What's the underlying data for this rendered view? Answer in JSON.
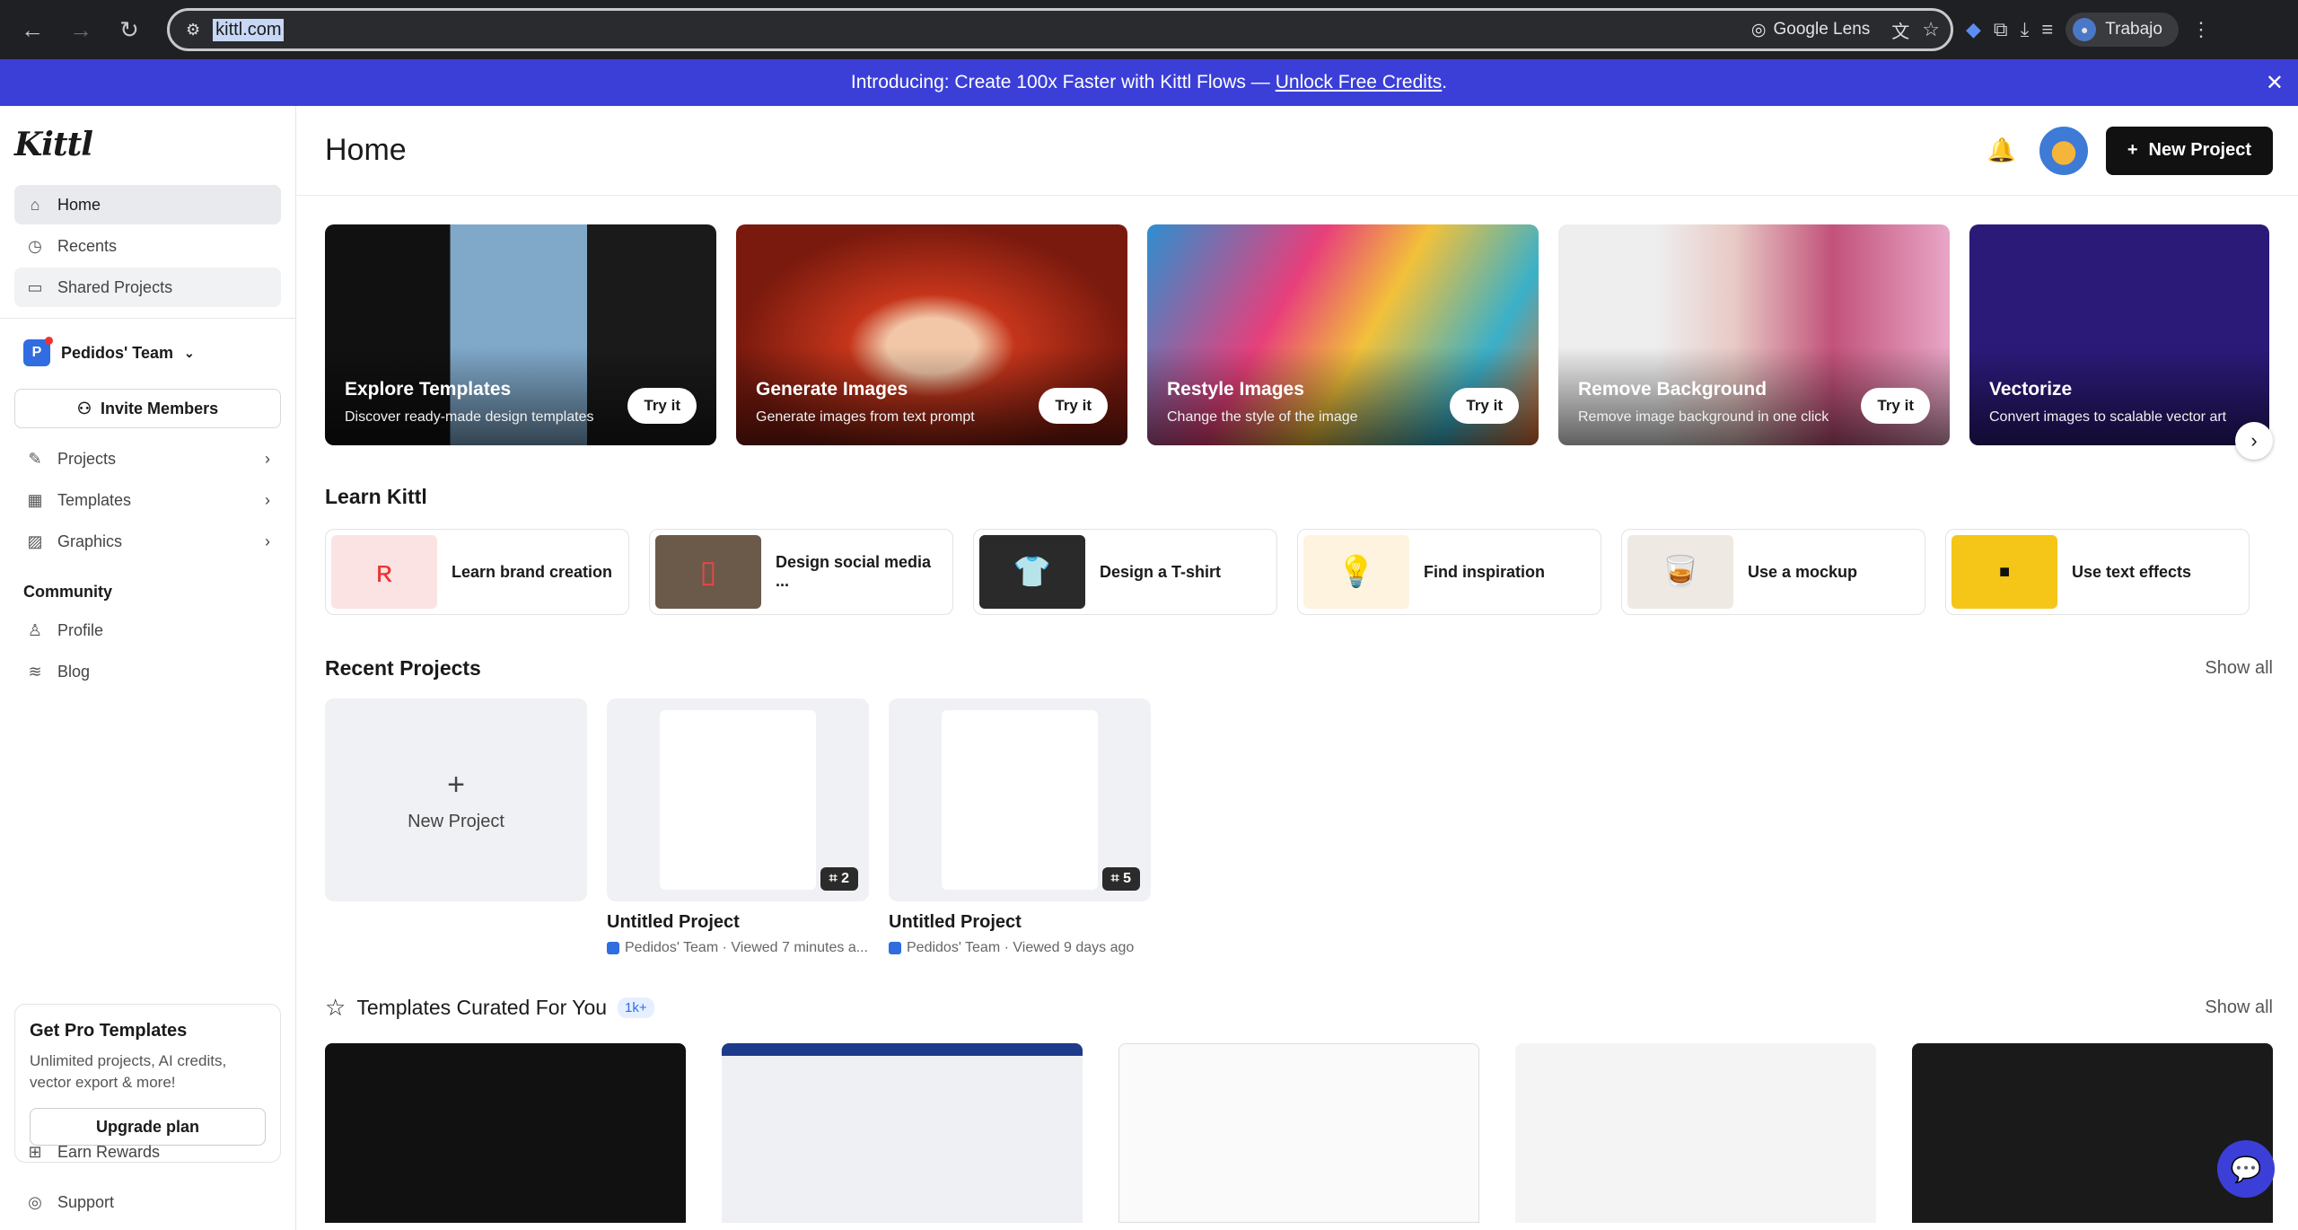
{
  "browser": {
    "url": "kittl.com",
    "lens_label": "Google Lens",
    "profile_label": "Trabajo"
  },
  "banner": {
    "text": "Introducing: Create 100x Faster with Kittl Flows —",
    "link": "Unlock Free Credits",
    "suffix": "."
  },
  "sidebar": {
    "logo": "Kittl",
    "nav": [
      {
        "label": "Home",
        "icon": "home-icon"
      },
      {
        "label": "Recents",
        "icon": "clock-icon"
      },
      {
        "label": "Shared Projects",
        "icon": "folder-icon"
      }
    ],
    "team_initial": "P",
    "team_name": "Pedidos' Team",
    "invite_label": "Invite Members",
    "sections": [
      {
        "label": "Projects",
        "icon": "edit-icon"
      },
      {
        "label": "Templates",
        "icon": "layout-icon"
      },
      {
        "label": "Graphics",
        "icon": "image-icon"
      }
    ],
    "community_title": "Community",
    "community": [
      {
        "label": "Profile",
        "icon": "user-icon"
      },
      {
        "label": "Blog",
        "icon": "rss-icon"
      }
    ],
    "pro": {
      "title": "Get Pro Templates",
      "desc": "Unlimited projects, AI credits, vector export & more!",
      "cta": "Upgrade plan"
    },
    "bottom": [
      {
        "label": "Earn Rewards",
        "icon": "gift-icon"
      },
      {
        "label": "Support",
        "icon": "support-icon"
      }
    ]
  },
  "header": {
    "title": "Home",
    "new_project": "New Project"
  },
  "tools": [
    {
      "title": "Explore Templates",
      "subtitle": "Discover ready-made design templates",
      "cta": "Try it"
    },
    {
      "title": "Generate Images",
      "subtitle": "Generate images from text prompt",
      "cta": "Try it"
    },
    {
      "title": "Restyle Images",
      "subtitle": "Change the style of the image",
      "cta": "Try it"
    },
    {
      "title": "Remove Background",
      "subtitle": "Remove image background in one click",
      "cta": "Try it"
    },
    {
      "title": "Vectorize",
      "subtitle": "Convert images to scalable vector art"
    }
  ],
  "learn": {
    "title": "Learn Kittl",
    "items": [
      {
        "label": "Learn brand creation"
      },
      {
        "label": "Design social media ..."
      },
      {
        "label": "Design a T-shirt"
      },
      {
        "label": "Find inspiration"
      },
      {
        "label": "Use a mockup"
      },
      {
        "label": "Use text effects"
      }
    ]
  },
  "recent": {
    "title": "Recent Projects",
    "show_all": "Show all",
    "new_label": "New Project",
    "projects": [
      {
        "name": "Untitled Project",
        "meta": "Pedidos' Team · Viewed 7 minutes a...",
        "count": "2"
      },
      {
        "name": "Untitled Project",
        "meta": "Pedidos' Team · Viewed 9 days ago",
        "count": "5"
      }
    ]
  },
  "curated": {
    "title": "Templates Curated For You",
    "badge": "1k+",
    "show_all": "Show all"
  }
}
